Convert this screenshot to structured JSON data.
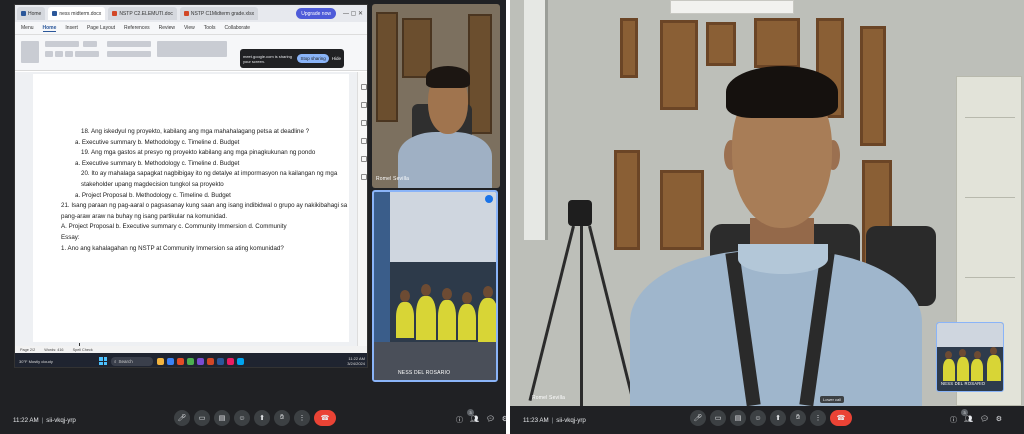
{
  "left_window": {
    "browser_tabs": [
      {
        "label": "Home",
        "active": false
      },
      {
        "label": "ness midterm.docx",
        "active": true
      },
      {
        "label": "NSTP C2.ELEMUTI.doc",
        "active": false
      },
      {
        "label": "NSTP C1Midterm grade.xlsx",
        "active": false
      }
    ],
    "upgrade_label": "Upgrade now",
    "ribbon_tabs": [
      "Menu",
      "Home",
      "Insert",
      "Page Layout",
      "References",
      "Review",
      "View",
      "Tools"
    ],
    "active_ribbon_tab": "Home",
    "collaborate_label": "Collaborate",
    "sharing_banner": {
      "message": "meet.google.com is sharing your screen.",
      "stop_button": "Stop sharing",
      "hide_button": "Hide"
    },
    "document_lines": [
      {
        "text": "18. Ang iskedyul ng proyekto, kabilang ang mga mahahalagang petsa at deadline ?",
        "indent": 2
      },
      {
        "text": "a.  Executive summary b.  Methodology c. Timeline  d.  Budget",
        "indent": 1
      },
      {
        "text": "19. Ang mga gastos at presyo ng proyekto kabilang ang mga pinagkukunan ng pondo",
        "indent": 2
      },
      {
        "text": "a.  Executive summary b.  Methodology  c. Timeline  d. Budget",
        "indent": 1
      },
      {
        "text": "20. Ito ay mahalaga sapagkat nagbibigay ito ng detalye at impormasyon na kailangan ng mga",
        "indent": 2
      },
      {
        "text": "stakeholder upang magdecision tungkol sa proyekto",
        "indent": 2
      },
      {
        "text": "a.  Project Proposal b.  Methodology  c. Timeline  d.  Budget",
        "indent": 1
      },
      {
        "text": "21. Isang paraan ng pag-aaral o pagsasanay kung saan ang isang indibidwal o grupo ay nakikibahagi sa",
        "indent": 0
      },
      {
        "text": "pang-araw araw na buhay ng isang partikular na  komunidad.",
        "indent": 0
      },
      {
        "text": "A.  Project Proposal    b.  Executive summary  c.  Community Immersion  d.  Community",
        "indent": 0
      },
      {
        "text": "Essay:",
        "indent": 0
      },
      {
        "text": "1.  Ano ang kahalagahan ng NSTP at Community Immersion sa ating komunidad?",
        "indent": 0
      }
    ],
    "status_bar": [
      "Page 2/2",
      "Words: 416",
      "Spell Check"
    ],
    "taskbar": {
      "weather": "30°F Mostly cloudy",
      "search_placeholder": "Search",
      "time": "11:22 AM",
      "date": "3/24/2024"
    }
  },
  "tiles": {
    "romel_small": {
      "name": "Romel Sevilla"
    },
    "ness_small": {
      "name": "NESS DEL ROSARIO"
    },
    "romel_main": {
      "name": "Romel Sevilla"
    },
    "ness_right": {
      "name": "NESS DEL ROSARIO"
    }
  },
  "meet_left": {
    "time": "11:22 AM",
    "meeting_code": "sii-vkqj-yrp",
    "participant_count": "3"
  },
  "meet_right": {
    "time": "11:23 AM",
    "meeting_code": "sii-vkqj-yrp",
    "lower_hand_tooltip": "Lower call",
    "participant_count": "3"
  },
  "colors": {
    "meet_bg": "#202124",
    "hangup": "#ea4335",
    "accent": "#8ab4f8"
  }
}
